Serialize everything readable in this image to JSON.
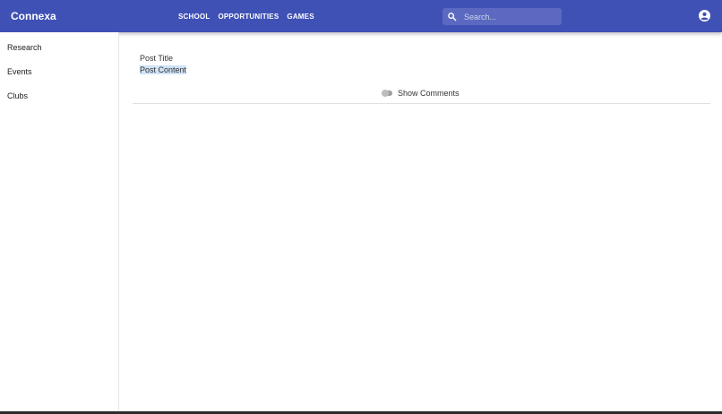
{
  "header": {
    "brand": "Connexa",
    "nav": [
      "SCHOOL",
      "OPPORTUNITIES",
      "GAMES"
    ],
    "search_placeholder": "Search...",
    "account_icon": "account-circle-icon",
    "bar_color": "#3f51b5"
  },
  "sidebar": {
    "items": [
      {
        "label": "Research"
      },
      {
        "label": "Events"
      },
      {
        "label": "Clubs"
      }
    ]
  },
  "post": {
    "title": "Post Title",
    "content": "Post Content",
    "comments_toggle_label": "Show Comments",
    "comments_visible": false
  }
}
